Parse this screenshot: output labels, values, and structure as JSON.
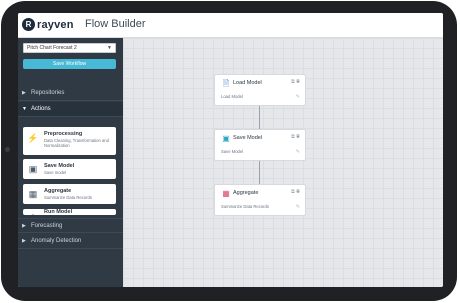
{
  "header": {
    "logo_mark": "R",
    "logo_text": "rayven",
    "title": "Flow Builder"
  },
  "sidebar": {
    "selected_flow": "Pitch Chart Forecast 2",
    "save_label": "Save Workflow",
    "collapse_label": "«",
    "sections": {
      "repositories": "Repositories",
      "actions": "Actions",
      "forecasting": "Forecasting",
      "anomaly": "Anomaly Detection"
    },
    "actions": [
      {
        "title": "Preprocessing",
        "desc": "Data Cleaning, Transformation and Normalization",
        "icon": "lightning-icon"
      },
      {
        "title": "Save Model",
        "desc": "Save model",
        "icon": "save-model-icon"
      },
      {
        "title": "Aggregate",
        "desc": "Summarize Data Records",
        "icon": "table-icon"
      },
      {
        "title": "Run Model",
        "desc": "",
        "icon": "run-icon"
      }
    ]
  },
  "canvas": {
    "nodes": [
      {
        "title": "Load Model",
        "subtitle": "Load Model",
        "icon": "document-icon",
        "color": "#3f7fc4"
      },
      {
        "title": "Save Model",
        "subtitle": "Save Model",
        "icon": "save-model-icon",
        "color": "#2ea6c9"
      },
      {
        "title": "Aggregate",
        "subtitle": "Summarize Data Records",
        "icon": "table-icon",
        "color": "#d94b6a"
      }
    ]
  }
}
